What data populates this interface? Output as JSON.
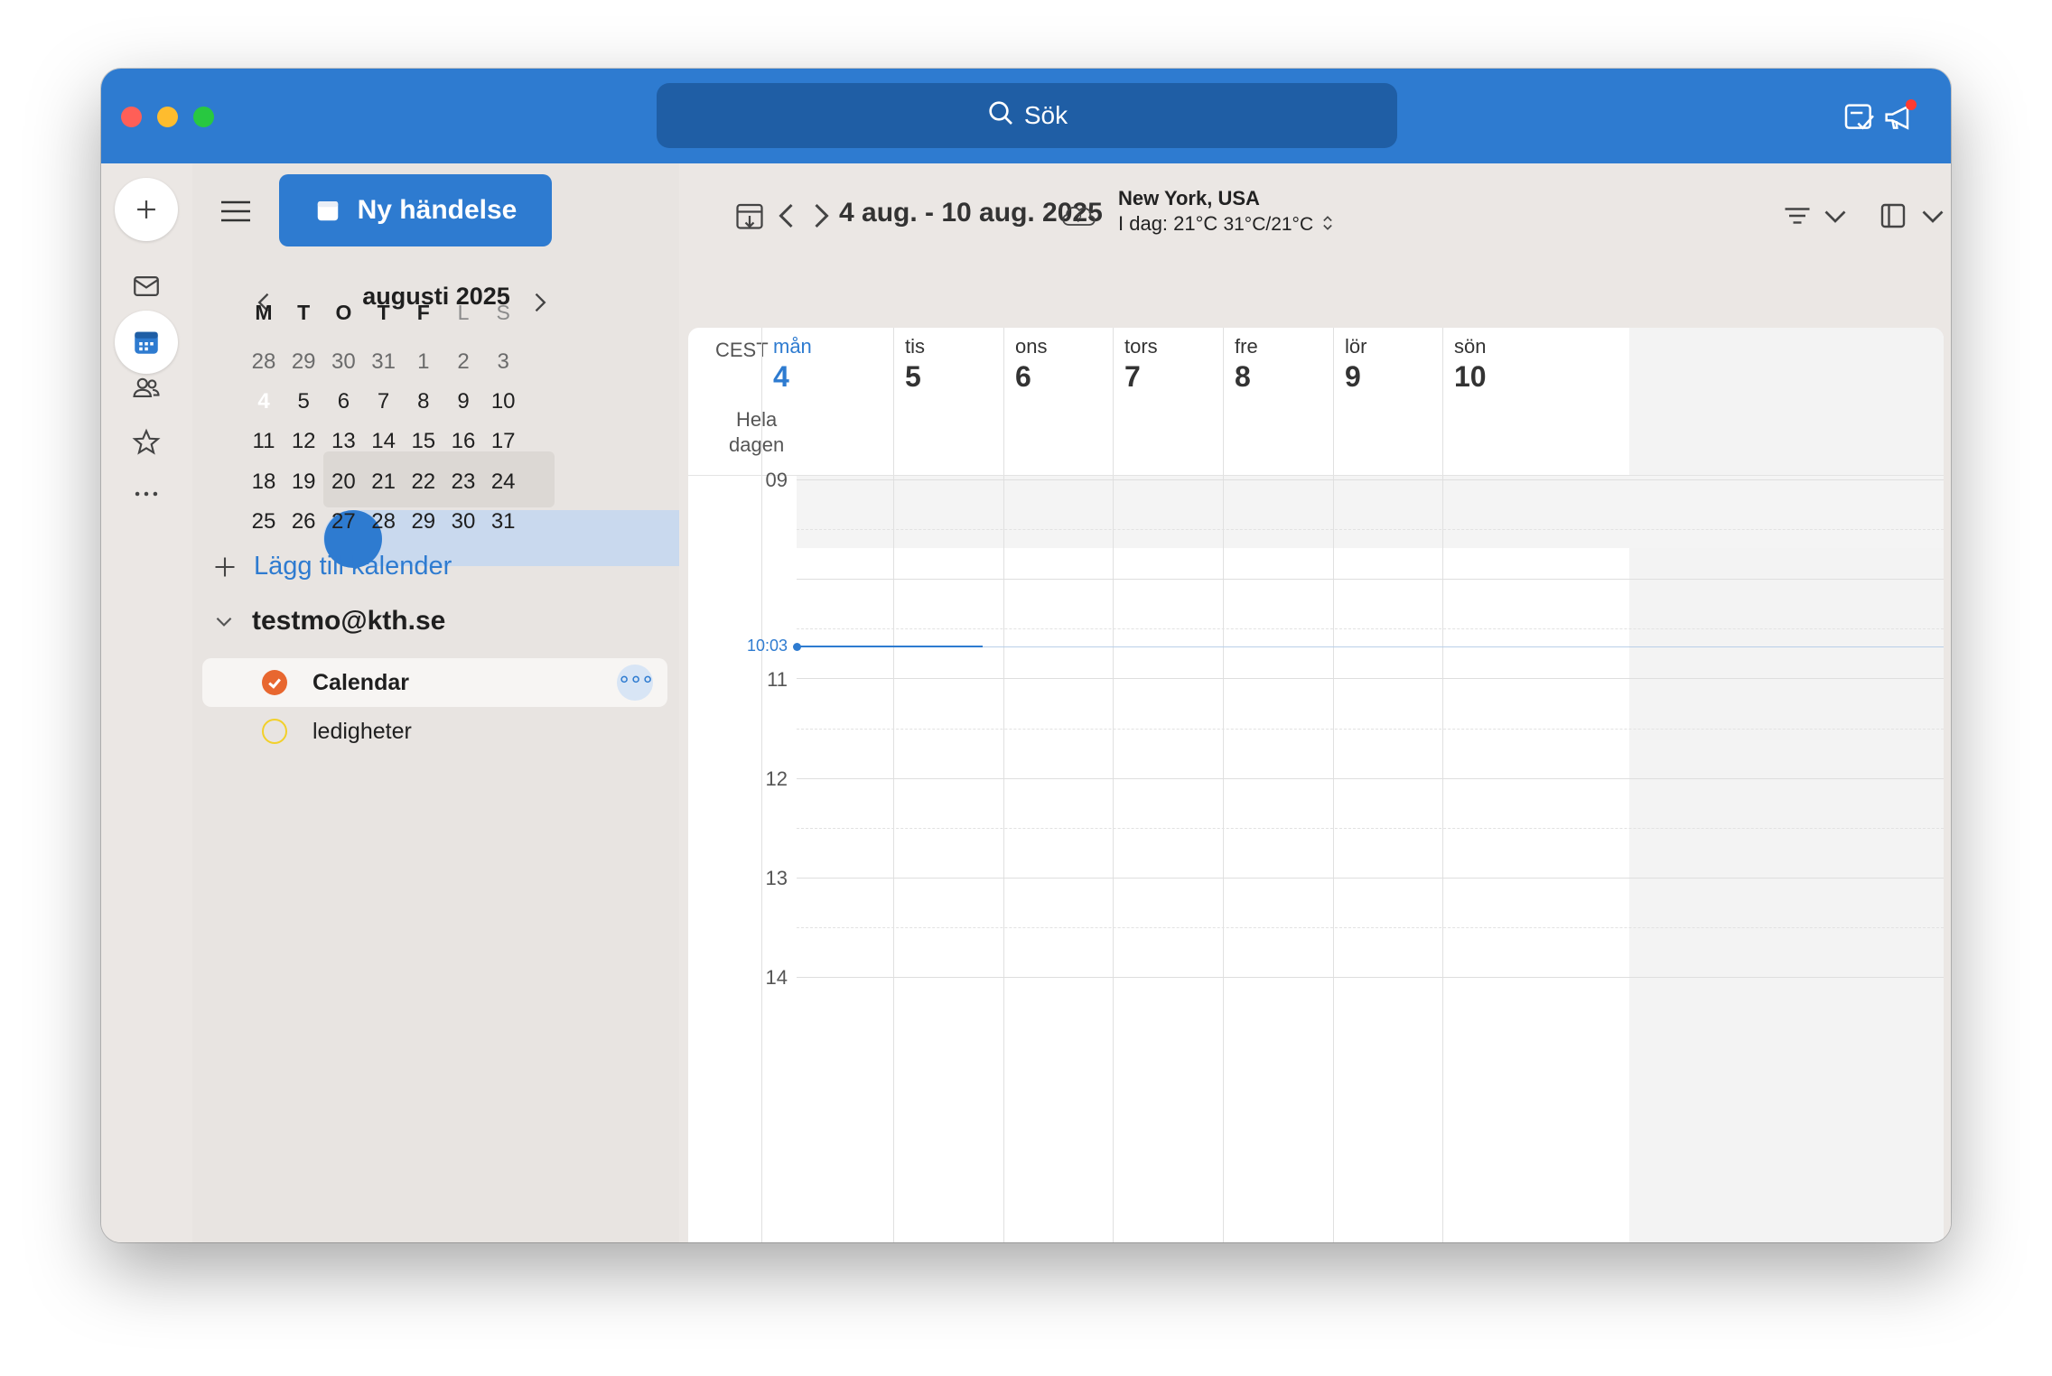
{
  "search": {
    "label": "Sök"
  },
  "sidebar": {
    "new_event_label": "Ny händelse",
    "mini_calendar": {
      "month_title": "augusti 2025",
      "weekdays": [
        "M",
        "T",
        "O",
        "T",
        "F",
        "L",
        "S"
      ],
      "weeks": [
        [
          "28",
          "29",
          "30",
          "31",
          "1",
          "2",
          "3"
        ],
        [
          "4",
          "5",
          "6",
          "7",
          "8",
          "9",
          "10"
        ],
        [
          "11",
          "12",
          "13",
          "14",
          "15",
          "16",
          "17"
        ],
        [
          "18",
          "19",
          "20",
          "21",
          "22",
          "23",
          "24"
        ],
        [
          "25",
          "26",
          "27",
          "28",
          "29",
          "30",
          "31"
        ]
      ]
    },
    "add_calendar_label": "Lägg till kalender",
    "account": "testmo@kth.se",
    "calendars": [
      {
        "name": "Calendar",
        "color": "#e8672f",
        "checked": true,
        "selected": true
      },
      {
        "name": "ledigheter",
        "color": "#f2d02a",
        "checked": false,
        "selected": false
      }
    ]
  },
  "toolbar": {
    "date_range": "4 aug. - 10 aug. 2025",
    "weather_location": "New York, USA",
    "weather_today": "I dag: 21°C",
    "weather_hilo": "31°C/21°C"
  },
  "week_view": {
    "timezone": "CEST",
    "all_day_label_1": "Hela",
    "all_day_label_2": "dagen",
    "days": [
      {
        "name": "mån",
        "num": "4",
        "today": true
      },
      {
        "name": "tis",
        "num": "5"
      },
      {
        "name": "ons",
        "num": "6"
      },
      {
        "name": "tors",
        "num": "7"
      },
      {
        "name": "fre",
        "num": "8"
      },
      {
        "name": "lör",
        "num": "9"
      },
      {
        "name": "sön",
        "num": "10"
      }
    ],
    "hours": [
      "09",
      "11",
      "12",
      "13",
      "14"
    ],
    "current_time": "10:03"
  },
  "colors": {
    "accent": "#2e7bd0",
    "titlebar": "#2e7bd0",
    "week_highlight": "#c9d9ee"
  },
  "icons": {
    "titlebar": [
      "search-icon",
      "sticky-note-icon",
      "megaphone-icon"
    ],
    "rail": [
      "plus-icon",
      "mail-icon",
      "calendar-icon",
      "people-icon",
      "star-icon",
      "more-icon"
    ]
  }
}
